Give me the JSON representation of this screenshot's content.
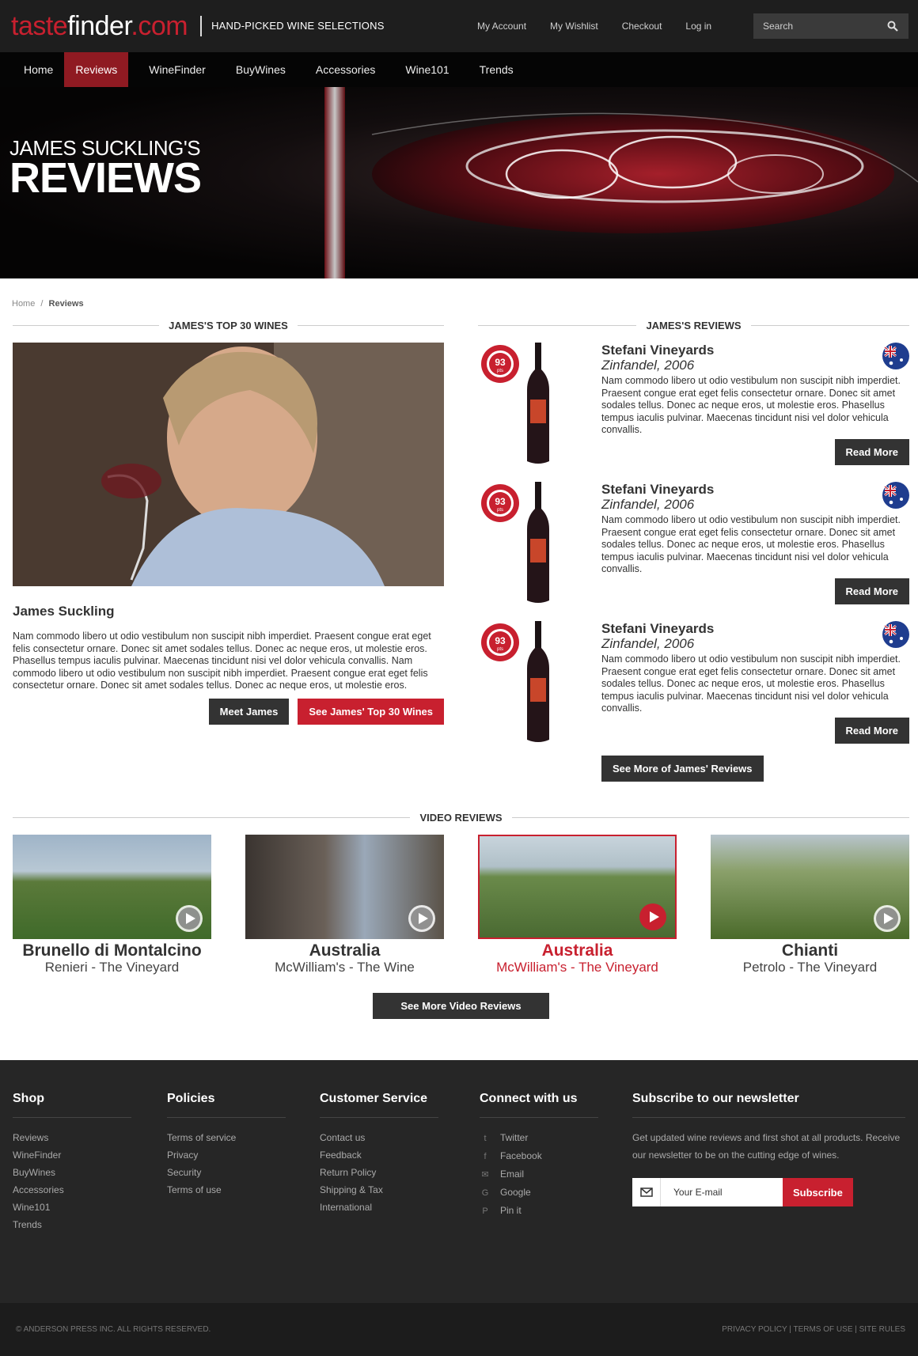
{
  "brand": {
    "logo_a": "taste",
    "logo_b": "finder",
    "logo_c": ".com",
    "tagline": "HAND-PICKED WINE SELECTIONS"
  },
  "topnav": [
    "My Account",
    "My Wishlist",
    "Checkout",
    "Log in"
  ],
  "search": {
    "placeholder": "Search"
  },
  "mainnav": [
    "Home",
    "Reviews",
    "WineFinder",
    "BuyWines",
    "Accessories",
    "Wine101",
    "Trends"
  ],
  "hero": {
    "line1": "JAMES SUCKLING'S",
    "line2": "REVIEWS"
  },
  "breadcrumb": {
    "home": "Home",
    "sep": "/",
    "current": "Reviews"
  },
  "top30": {
    "heading": "JAMES'S TOP 30 WINES",
    "name": "James Suckling",
    "bio": "Nam commodo libero ut odio vestibulum non suscipit nibh imperdiet. Praesent congue erat eget felis consectetur ornare. Donec sit amet sodales tellus. Donec ac neque eros, ut molestie eros. Phasellus tempus iaculis pulvinar. Maecenas tincidunt nisi vel dolor vehicula convallis. Nam commodo libero ut odio vestibulum non suscipit nibh imperdiet. Praesent congue erat eget felis consectetur ornare. Donec sit amet sodales tellus. Donec ac neque eros, ut molestie eros.",
    "meet_btn": "Meet James",
    "top_btn": "See James' Top 30 Wines"
  },
  "reviews": {
    "heading": "JAMES'S REVIEWS",
    "items": [
      {
        "score": "93",
        "unit": "pts",
        "winery": "Stefani Vineyards",
        "wine": "Zinfandel, 2006",
        "text": "Nam commodo libero ut odio vestibulum non suscipit nibh imperdiet. Praesent congue erat eget felis consectetur ornare. Donec sit amet sodales tellus. Donec ac neque eros, ut molestie eros. Phasellus tempus iaculis pulvinar. Maecenas tincidunt nisi vel dolor vehicula convallis.",
        "btn": "Read More",
        "flag": "australia-flag-icon"
      },
      {
        "score": "93",
        "unit": "pts",
        "winery": "Stefani Vineyards",
        "wine": "Zinfandel, 2006",
        "text": "Nam commodo libero ut odio vestibulum non suscipit nibh imperdiet. Praesent congue erat eget felis consectetur ornare. Donec sit amet sodales tellus. Donec ac neque eros, ut molestie eros. Phasellus tempus iaculis pulvinar. Maecenas tincidunt nisi vel dolor vehicula convallis.",
        "btn": "Read More",
        "flag": "australia-flag-icon"
      },
      {
        "score": "93",
        "unit": "pts",
        "winery": "Stefani Vineyards",
        "wine": "Zinfandel, 2006",
        "text": "Nam commodo libero ut odio vestibulum non suscipit nibh imperdiet. Praesent congue erat eget felis consectetur ornare. Donec sit amet sodales tellus. Donec ac neque eros, ut molestie eros. Phasellus tempus iaculis pulvinar. Maecenas tincidunt nisi vel dolor vehicula convallis.",
        "btn": "Read More",
        "flag": "australia-flag-icon"
      }
    ],
    "more_btn": "See More of James' Reviews"
  },
  "videos": {
    "heading": "VIDEO REVIEWS",
    "items": [
      {
        "title": "Brunello di Montalcino",
        "sub": "Renieri - The Vineyard"
      },
      {
        "title": "Australia",
        "sub": "McWilliam's - The Wine"
      },
      {
        "title": "Australia",
        "sub": "McWilliam's - The Vineyard"
      },
      {
        "title": "Chianti",
        "sub": "Petrolo - The Vineyard"
      }
    ],
    "more_btn": "See More Video Reviews"
  },
  "footer": {
    "shop": {
      "title": "Shop",
      "links": [
        "Reviews",
        "WineFinder",
        "BuyWines",
        "Accessories",
        "Wine101",
        "Trends"
      ]
    },
    "policies": {
      "title": "Policies",
      "links": [
        "Terms of service",
        "Privacy",
        "Security",
        "Terms of use"
      ]
    },
    "service": {
      "title": "Customer Service",
      "links": [
        "Contact us",
        "Feedback",
        "Return Policy",
        "Shipping & Tax",
        "International"
      ]
    },
    "connect": {
      "title": "Connect with us",
      "links": [
        "Twitter",
        "Facebook",
        "Email",
        "Google",
        "Pin it"
      ]
    },
    "newsletter": {
      "title": "Subscribe to our newsletter",
      "text": "Get updated wine reviews and first shot at all products. Receive our newsletter to be on the cutting edge of wines.",
      "placeholder": "Your E-mail",
      "btn": "Subscribe"
    },
    "copyright": "© ANDERSON PRESS INC.   ALL RIGHTS RESERVED.",
    "legal": "PRIVACY POLICY | TERMS OF USE | SITE RULES"
  },
  "colors": {
    "accent": "#c8202f",
    "dark": "#1e1e1e",
    "active_nav": "#8f1a22"
  }
}
